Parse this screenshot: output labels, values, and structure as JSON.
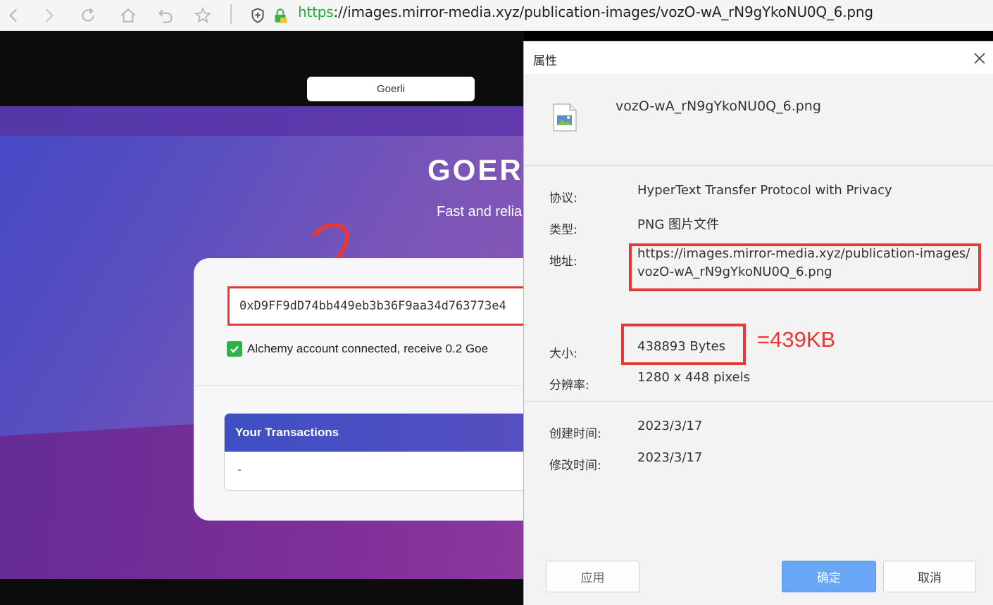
{
  "browser": {
    "url_scheme": "https",
    "url_rest": "://images.mirror-media.xyz/publication-images/vozO-wA_rN9gYkoNU0Q_6.png",
    "icons": [
      "back-icon",
      "forward-icon",
      "refresh-icon",
      "home-icon",
      "undo-icon",
      "star-icon",
      "shield-icon",
      "lock-icon"
    ]
  },
  "page": {
    "network_label": "Goerli",
    "hero_title": "GOER",
    "hero_subtitle": "Fast and relia",
    "annotation_number": "2",
    "address": "0xD9FF9dD74bb449eb3b36F9aa34d763773e4",
    "status_text": "Alchemy account connected, receive 0.2 Goe",
    "transactions_title": "Your Transactions",
    "transactions_empty": "-"
  },
  "dialog": {
    "title": "属性",
    "file_name": "vozO-wA_rN9gYkoNU0Q_6.png",
    "protocol_label": "协议:",
    "protocol_value": "HyperText Transfer Protocol with Privacy",
    "type_label": "类型:",
    "type_value": "PNG 图片文件",
    "address_label": "地址:",
    "address_line1": "https://images.mirror-media.xyz/publication-images/",
    "address_line2": "vozO-wA_rN9gYkoNU0Q_6.png",
    "size_label": "大小:",
    "size_value": "438893 Bytes",
    "size_annotation": "=439KB",
    "resolution_label": "分辨率:",
    "resolution_value": "1280 x 448 pixels",
    "created_label": "创建时间:",
    "created_value": "2023/3/17",
    "modified_label": "修改时间:",
    "modified_value": "2023/3/17",
    "apply_button": "应用",
    "ok_button": "确定",
    "cancel_button": "取消"
  },
  "colors": {
    "annotation_red": "#e53935",
    "url_green": "#1faa3a",
    "ok_blue": "#6aa6f8"
  }
}
